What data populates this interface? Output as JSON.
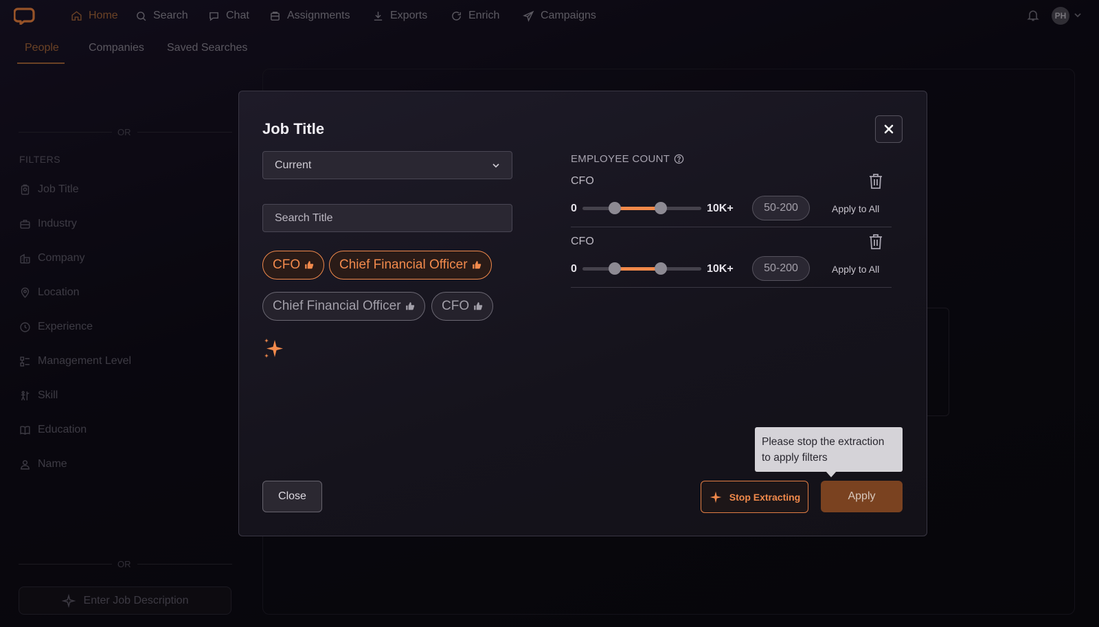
{
  "nav": {
    "items": [
      {
        "label": "Home",
        "icon": "home-icon",
        "active": true
      },
      {
        "label": "Search",
        "icon": "search-icon"
      },
      {
        "label": "Chat",
        "icon": "chat-icon"
      },
      {
        "label": "Assignments",
        "icon": "assignments-icon"
      },
      {
        "label": "Exports",
        "icon": "download-icon"
      },
      {
        "label": "Enrich",
        "icon": "refresh-icon"
      },
      {
        "label": "Campaigns",
        "icon": "send-icon"
      }
    ],
    "avatar_initials": "PH"
  },
  "subtabs": [
    "People",
    "Companies",
    "Saved Searches"
  ],
  "sidebar": {
    "or_label": "OR",
    "filters_heading": "FILTERS",
    "filters": [
      {
        "label": "Job Title",
        "icon": "badge-icon"
      },
      {
        "label": "Industry",
        "icon": "briefcase-icon"
      },
      {
        "label": "Company",
        "icon": "building-icon"
      },
      {
        "label": "Location",
        "icon": "map-pin-icon"
      },
      {
        "label": "Experience",
        "icon": "clock-icon"
      },
      {
        "label": "Management Level",
        "icon": "hierarchy-icon"
      },
      {
        "label": "Skill",
        "icon": "skill-icon"
      },
      {
        "label": "Education",
        "icon": "book-icon"
      },
      {
        "label": "Name",
        "icon": "user-icon"
      }
    ],
    "job_description_button": "Enter Job Description"
  },
  "modal": {
    "title": "Job Title",
    "select_value": "Current",
    "search_placeholder": "Search Title",
    "chips_selected": [
      "CFO",
      "Chief Financial Officer"
    ],
    "chips_suggested": [
      "Chief Financial Officer",
      "CFO"
    ],
    "employee_count_heading": "EMPLOYEE COUNT",
    "employee_rows": [
      {
        "label": "CFO",
        "min_label": "0",
        "max_label": "10K+",
        "range": "50-200",
        "apply_all": "Apply to All",
        "range_low_frac": 0.27,
        "range_high_frac": 0.66
      },
      {
        "label": "CFO",
        "min_label": "0",
        "max_label": "10K+",
        "range": "50-200",
        "apply_all": "Apply to All",
        "range_low_frac": 0.27,
        "range_high_frac": 0.66
      }
    ],
    "close_button": "Close",
    "stop_button": "Stop Extracting",
    "apply_button": "Apply",
    "tooltip": "Please stop the extraction to apply filters"
  },
  "colors": {
    "accent": "#f28a4c",
    "apply_bg": "#7a4220",
    "background": "#0f0c17"
  }
}
